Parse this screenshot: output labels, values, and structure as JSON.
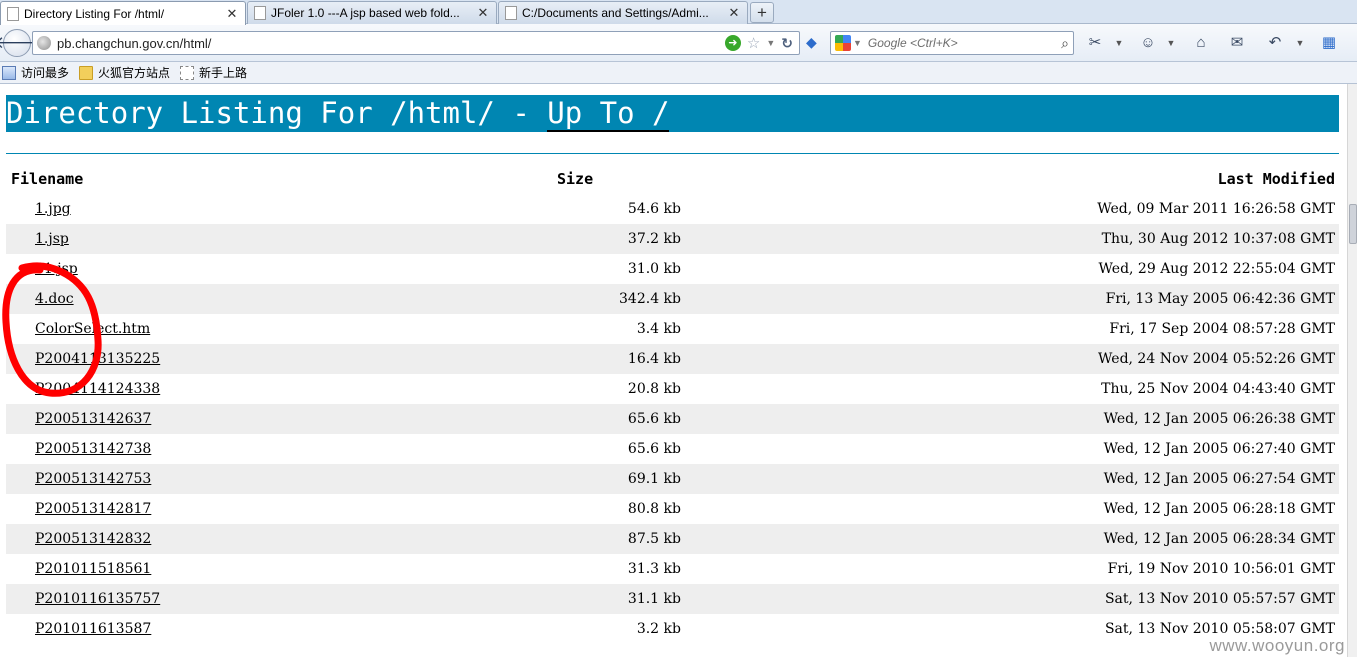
{
  "tabs": [
    {
      "label": "Directory Listing For /html/",
      "active": true
    },
    {
      "label": "JFoler 1.0 ---A jsp based web fold...",
      "active": false
    },
    {
      "label": "C:/Documents and Settings/Admi...",
      "active": false
    }
  ],
  "newtab_label": "+",
  "address": {
    "url": "pb.changchun.gov.cn/html/"
  },
  "search": {
    "placeholder": "Google <Ctrl+K>"
  },
  "bookmarks": [
    {
      "label": "访问最多",
      "icon": "most-visited-icon"
    },
    {
      "label": "火狐官方站点",
      "icon": "folder-icon"
    },
    {
      "label": "新手上路",
      "icon": "blank-page-icon"
    }
  ],
  "page": {
    "title_prefix": "Directory Listing For /html/ - ",
    "up_link": "Up To /",
    "header_color": "#0086b2"
  },
  "listing": {
    "columns": [
      "Filename",
      "Size",
      "Last Modified"
    ],
    "rows": [
      {
        "name": "1.jpg",
        "size": "54.6 kb",
        "modified": "Wed, 09 Mar 2011 16:26:58 GMT"
      },
      {
        "name": "1.jsp",
        "size": "37.2 kb",
        "modified": "Thu, 30 Aug 2012 10:37:08 GMT"
      },
      {
        "name": "31.jsp",
        "size": "31.0 kb",
        "modified": "Wed, 29 Aug 2012 22:55:04 GMT"
      },
      {
        "name": "4.doc",
        "size": "342.4 kb",
        "modified": "Fri, 13 May 2005 06:42:36 GMT"
      },
      {
        "name": "ColorSelect.htm",
        "size": "3.4 kb",
        "modified": "Fri, 17 Sep 2004 08:57:28 GMT"
      },
      {
        "name": "P2004113135225",
        "size": "16.4 kb",
        "modified": "Wed, 24 Nov 2004 05:52:26 GMT"
      },
      {
        "name": "P2004114124338",
        "size": "20.8 kb",
        "modified": "Thu, 25 Nov 2004 04:43:40 GMT"
      },
      {
        "name": "P200513142637",
        "size": "65.6 kb",
        "modified": "Wed, 12 Jan 2005 06:26:38 GMT"
      },
      {
        "name": "P200513142738",
        "size": "65.6 kb",
        "modified": "Wed, 12 Jan 2005 06:27:40 GMT"
      },
      {
        "name": "P200513142753",
        "size": "69.1 kb",
        "modified": "Wed, 12 Jan 2005 06:27:54 GMT"
      },
      {
        "name": "P200513142817",
        "size": "80.8 kb",
        "modified": "Wed, 12 Jan 2005 06:28:18 GMT"
      },
      {
        "name": "P200513142832",
        "size": "87.5 kb",
        "modified": "Wed, 12 Jan 2005 06:28:34 GMT"
      },
      {
        "name": "P201011518561",
        "size": "31.3 kb",
        "modified": "Fri, 19 Nov 2010 10:56:01 GMT"
      },
      {
        "name": "P2010116135757",
        "size": "31.1 kb",
        "modified": "Sat, 13 Nov 2010 05:57:57 GMT"
      },
      {
        "name": "P201011613587",
        "size": "3.2 kb",
        "modified": "Sat, 13 Nov 2010 05:58:07 GMT"
      }
    ]
  },
  "watermark": "www.wooyun.org",
  "annotation_color": "#ff0000"
}
